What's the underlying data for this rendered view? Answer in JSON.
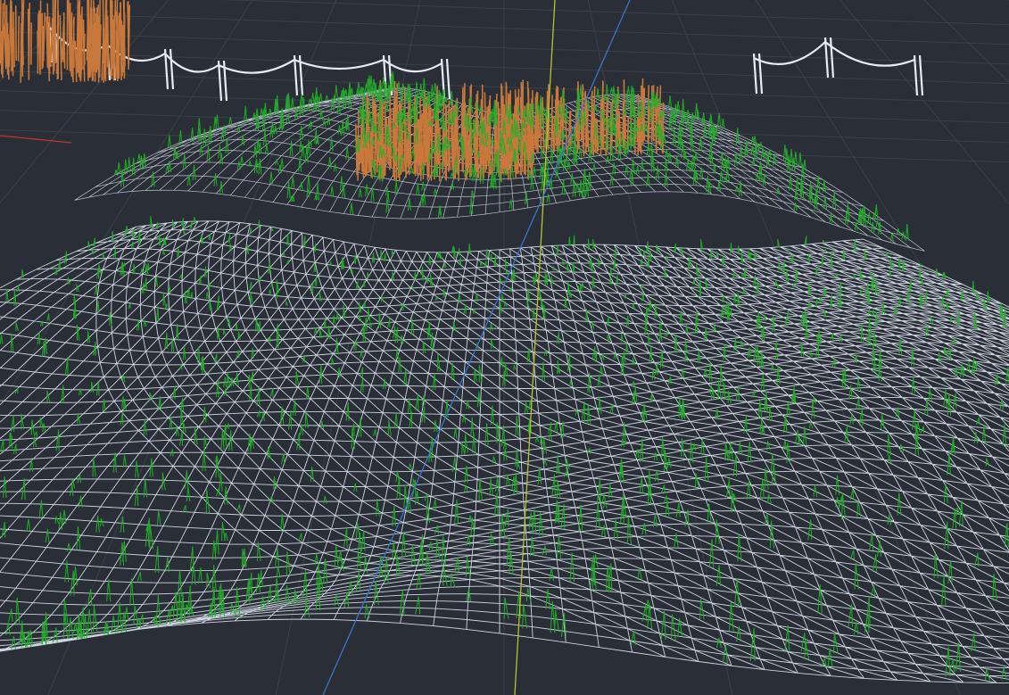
{
  "viewport": {
    "background_color": "#2a2e36",
    "grid_color": "#3b404a",
    "terrain_wire_color": "#eaf2ff",
    "terrain_fill_color": "#3a3f4a",
    "grass_color": "#22b02a",
    "shrub_color": "#c7783a",
    "fence_color": "#e6ecf5",
    "axis_y_color": "#b7c230",
    "axis_z_color": "#3b74c8",
    "axis_x_color": "#c0392b",
    "shading": "wireframe"
  }
}
